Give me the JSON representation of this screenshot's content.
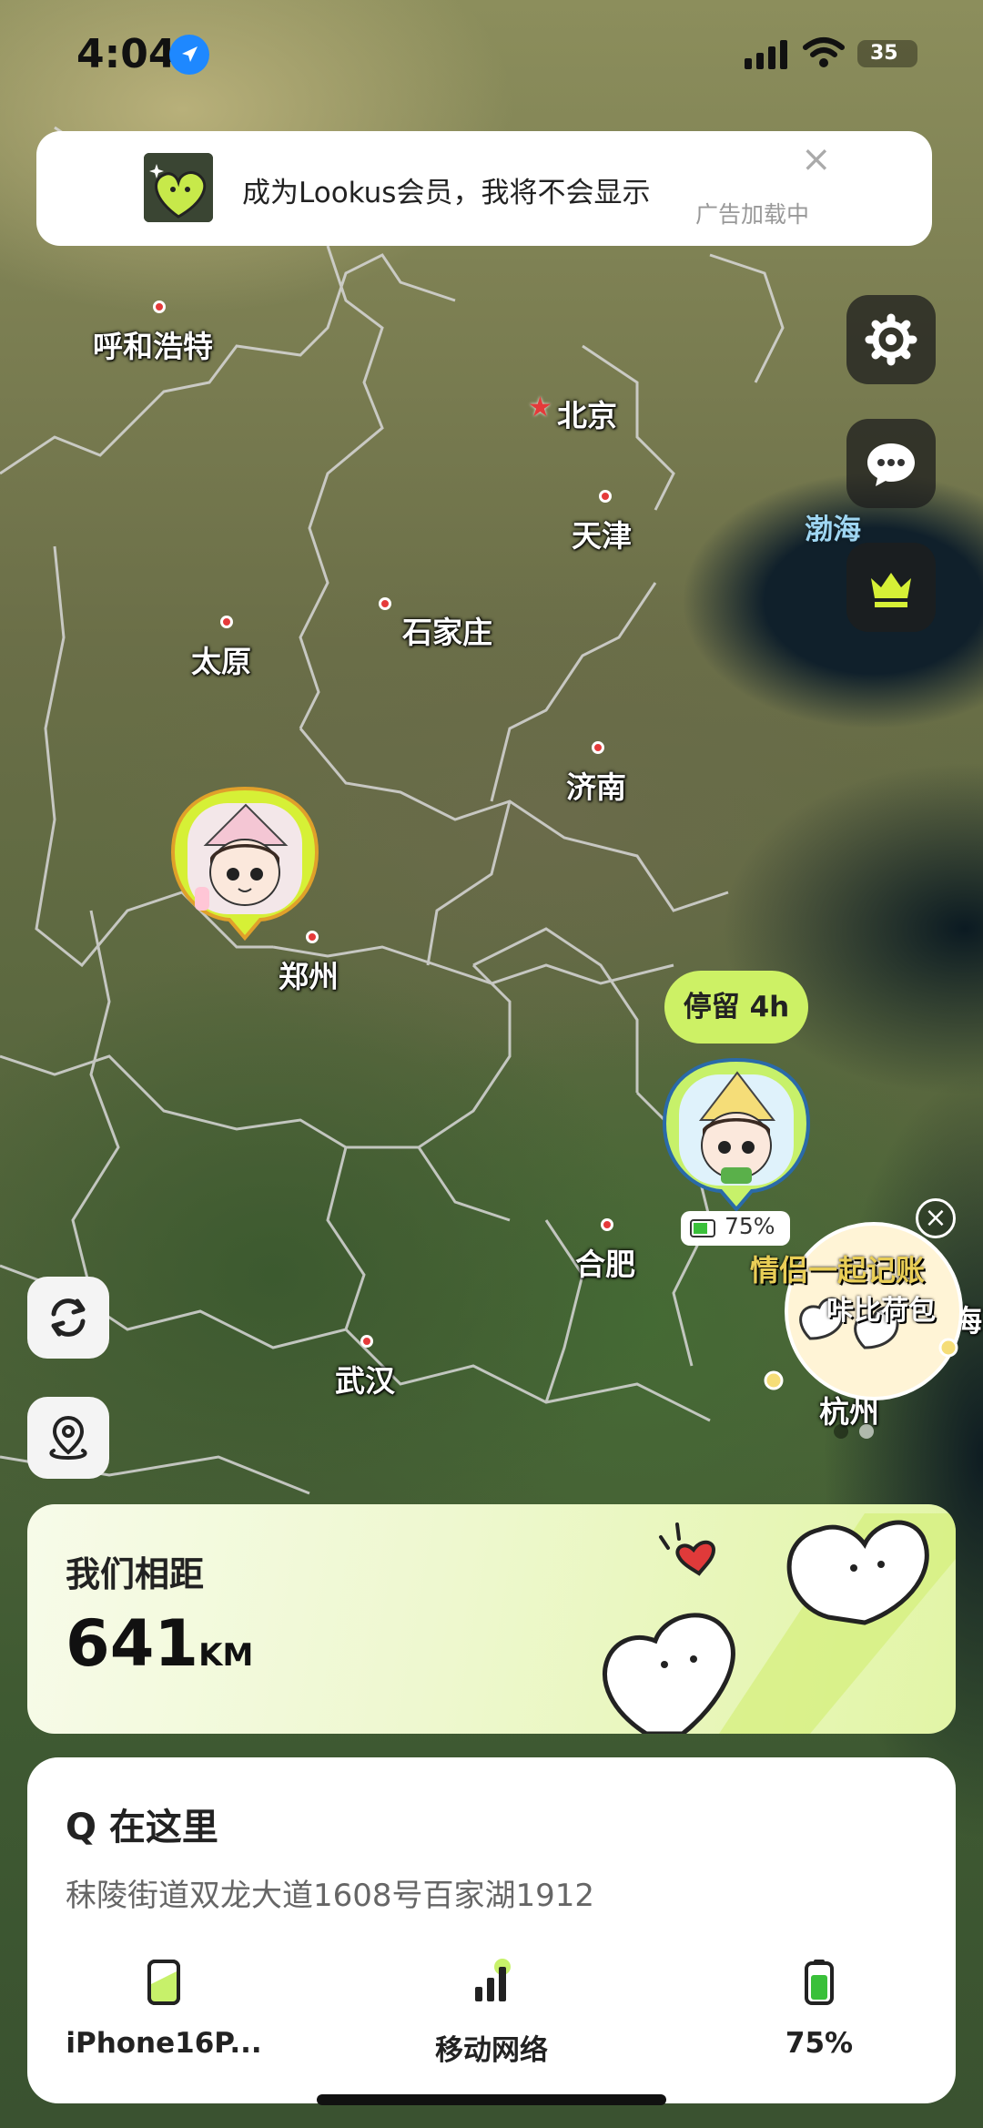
{
  "status_bar": {
    "time": "4:04",
    "battery_level": "35"
  },
  "ad": {
    "text": "成为Lookus会员，我将不会显示",
    "loading": "广告加载中",
    "close_label": "×"
  },
  "map": {
    "cities": [
      {
        "name": "呼和浩特"
      },
      {
        "name": "北京"
      },
      {
        "name": "天津"
      },
      {
        "name": "石家庄"
      },
      {
        "name": "太原"
      },
      {
        "name": "济南"
      },
      {
        "name": "郑州"
      },
      {
        "name": "合肥"
      },
      {
        "name": "武汉"
      },
      {
        "name": "杭州"
      }
    ],
    "sea_label": "渤海",
    "partial_label": "海"
  },
  "partner": {
    "stay_badge": "停留 4h",
    "battery_text": "75%",
    "battery_fraction": 0.75
  },
  "promo": {
    "title": "情侣一起记账",
    "subtitle": "咔比荷包",
    "close_label": "×"
  },
  "distance_card": {
    "label": "我们相距",
    "value": "641",
    "unit": "KM"
  },
  "info_panel": {
    "title": "Q 在这里",
    "address": "秣陵街道双龙大道1608号百家湖1912",
    "stats": [
      {
        "icon": "phone-icon",
        "label": "iPhone16P..."
      },
      {
        "icon": "cellular-icon",
        "label": "移动网络"
      },
      {
        "icon": "battery-icon",
        "label": "75%"
      }
    ]
  },
  "colors": {
    "accent_green": "#cdf165",
    "city_dot": "#e53a3a",
    "card_gradient_end": "#e2f5a6"
  }
}
